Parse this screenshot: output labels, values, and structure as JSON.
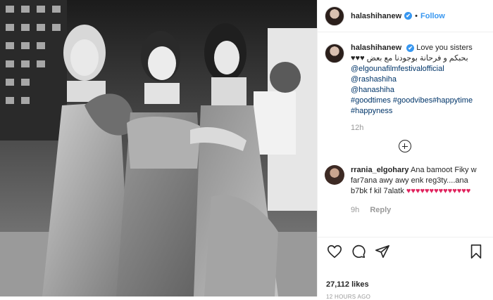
{
  "post": {
    "username": "halashihanew",
    "verified_mark": "✔",
    "separator": "•",
    "follow_label": "Follow"
  },
  "caption": {
    "username": "halashihanew",
    "text": "Love you sisters",
    "arabic_line": "بحبكم و فرحانة بوجودنا مع بعض ♥♥♥",
    "links": [
      "@elgounafilmfestivalofficial",
      "@rashashiha",
      "@hanashiha",
      "#goodtimes #goodvibes#happytime",
      "#happyness"
    ],
    "time": "12h"
  },
  "comment": {
    "username": "rrania_elgohary",
    "text": "Ana bamoot Fiky w far7ana awy awy enk reg3ty....ana b7bk f kil 7alatk",
    "hearts": "♥♥♥♥♥♥♥♥♥♥♥♥♥♥",
    "time": "9h",
    "reply_label": "Reply"
  },
  "footer": {
    "likes": "27,112 likes",
    "timestamp": "12 HOURS AGO"
  },
  "icons": {
    "like": "heart-icon",
    "comment": "comment-icon",
    "share": "share-icon",
    "save": "bookmark-icon",
    "add": "plus-circle-icon"
  }
}
